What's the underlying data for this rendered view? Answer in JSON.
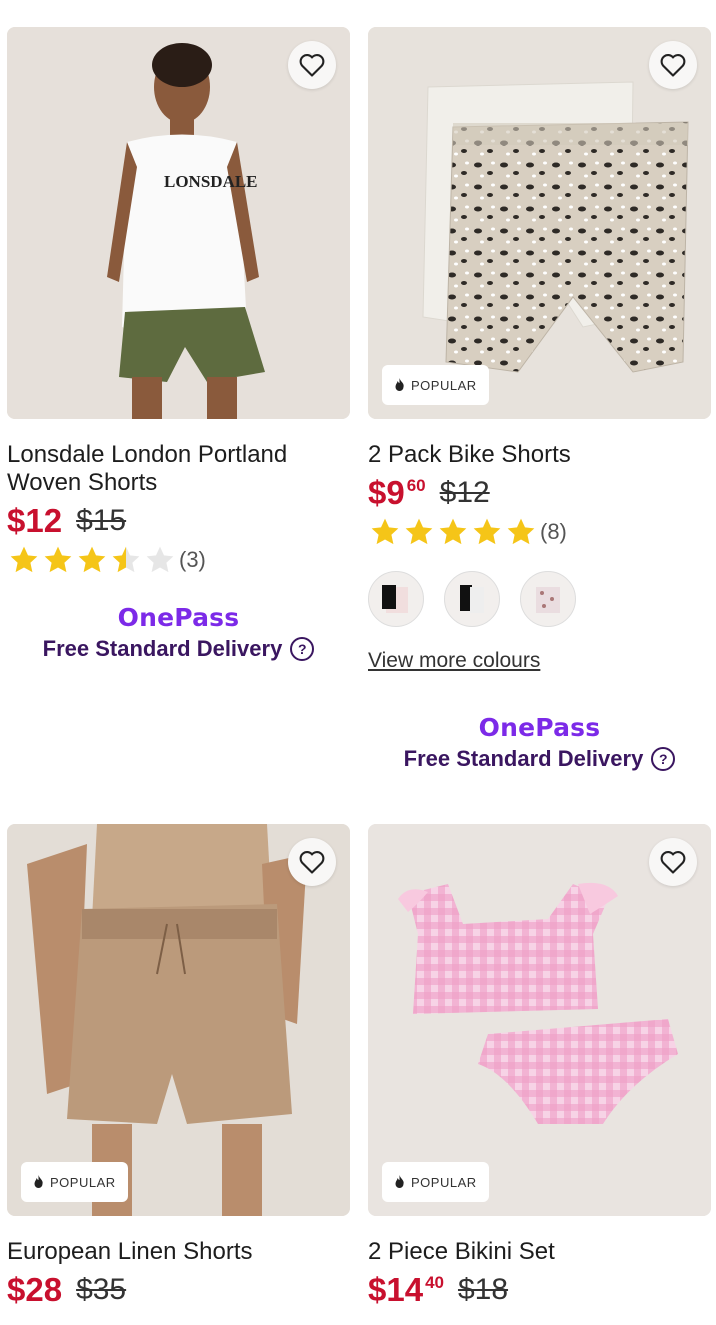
{
  "products": [
    {
      "title": "Lonsdale London Portland Woven Shorts",
      "price": "$12",
      "was_price": "$15",
      "rating": 3.5,
      "review_count": "(3)",
      "onepass_logo": "OnePass",
      "delivery": "Free Standard Delivery",
      "shirt_text": "LONSDALE"
    },
    {
      "title": "2 Pack Bike Shorts",
      "price_dollars": "$9",
      "price_cents": "60",
      "was_price": "$12",
      "rating": 5,
      "review_count": "(8)",
      "badge": "POPULAR",
      "view_more": "View more colours",
      "onepass_logo": "OnePass",
      "delivery": "Free Standard Delivery"
    },
    {
      "title": "European Linen Shorts",
      "price": "$28",
      "was_price": "$35",
      "badge": "POPULAR"
    },
    {
      "title": "2 Piece Bikini Set",
      "price_dollars": "$14",
      "price_cents": "40",
      "was_price": "$18",
      "badge": "POPULAR"
    }
  ],
  "colors": {
    "sale_red": "#c8102e",
    "star_yellow": "#f5c518",
    "onepass_purple": "#7c2ae8",
    "delivery_dark_purple": "#3a1660"
  }
}
